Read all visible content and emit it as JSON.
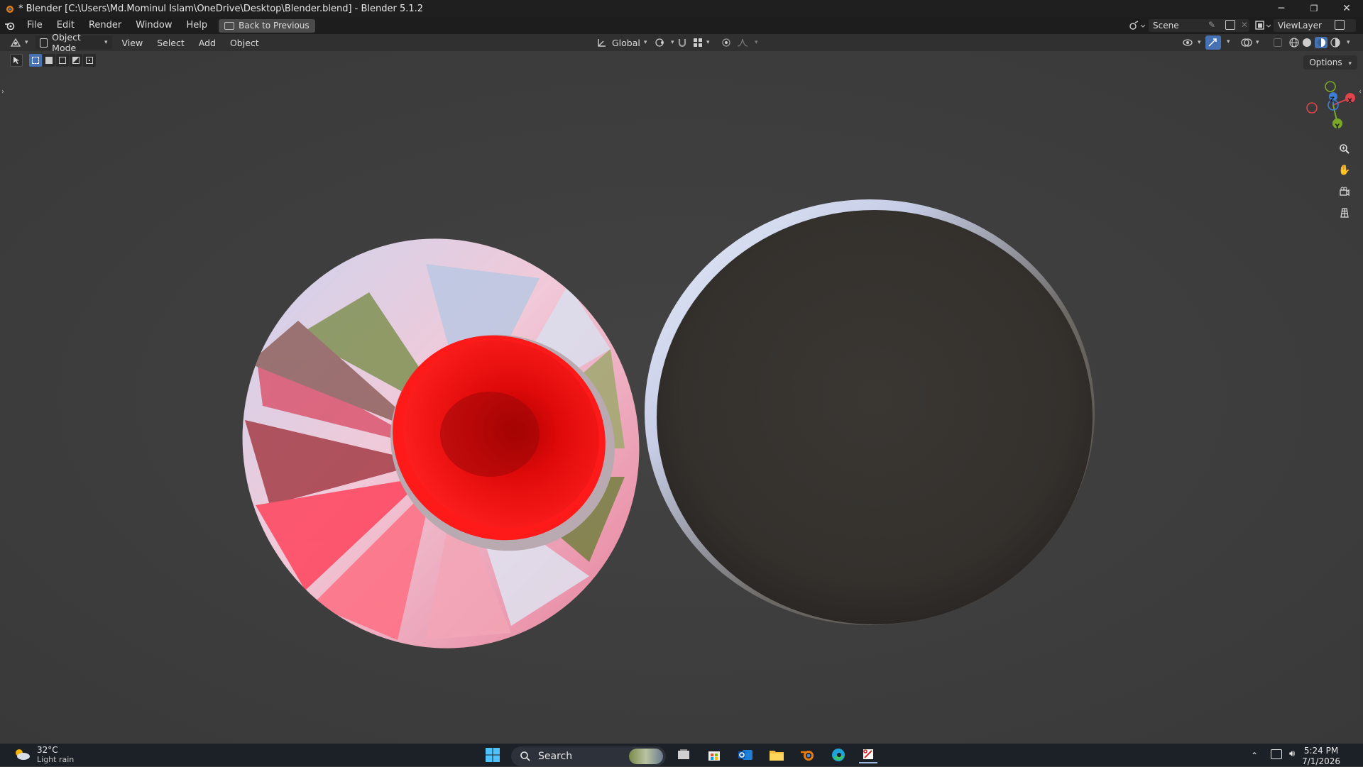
{
  "window": {
    "title": "* Blender [C:\\Users\\Md.Mominul Islam\\OneDrive\\Desktop\\Blender.blend] - Blender 5.1.2",
    "minimize": "─",
    "maximize": "❐",
    "close": "✕"
  },
  "menu": {
    "items": [
      "File",
      "Edit",
      "Render",
      "Window",
      "Help"
    ],
    "back_button": "Back to Previous",
    "scene": "Scene",
    "view_layer": "ViewLayer"
  },
  "header": {
    "mode": "Object Mode",
    "menus": [
      "View",
      "Select",
      "Add",
      "Object"
    ],
    "transform_orientation": "Global"
  },
  "viewport": {
    "options_label": "Options",
    "gizmo": {
      "x": "X",
      "y": "Y",
      "z": "Z"
    }
  },
  "colors": {
    "axis_x": "#e0434b",
    "axis_y": "#7aa928",
    "axis_z": "#3b7fd8"
  },
  "taskbar": {
    "weather_temp": "32°C",
    "weather_cond": "Light rain",
    "search_placeholder": "Search",
    "time": "5:24 PM",
    "date": "7/1/2026"
  }
}
